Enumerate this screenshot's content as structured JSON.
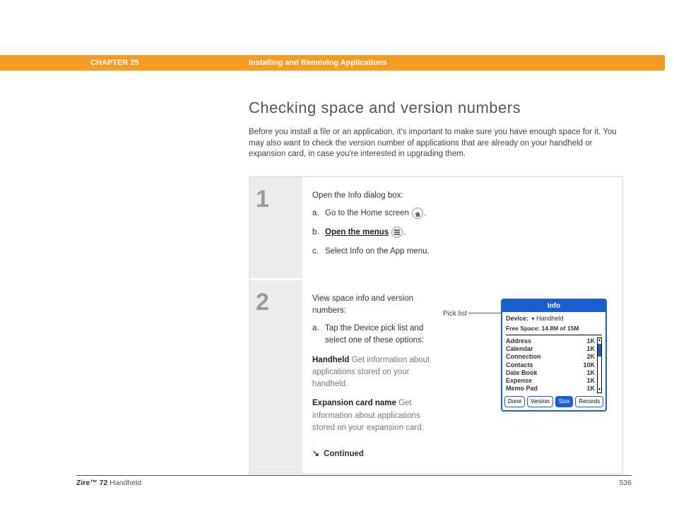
{
  "header": {
    "chapter": "CHAPTER 25",
    "title": "Installing and Removing Applications"
  },
  "page": {
    "heading": "Checking space and version numbers",
    "intro": "Before you install a file or an application, it's important to make sure you have enough space for it. You may also want to check the version number of applications that are already on your handheld or expansion card, in case you're interested in upgrading them."
  },
  "step1": {
    "num": "1",
    "lead": "Open the Info dialog box:",
    "a_letter": "a.",
    "a_text": "Go to the Home screen ",
    "a_post": ".",
    "b_letter": "b.",
    "b_link": "Open the menus",
    "b_post": ".",
    "c_letter": "c.",
    "c_text": "Select Info on the App menu."
  },
  "step2": {
    "num": "2",
    "lead": "View space info and version numbers:",
    "a_letter": "a.",
    "a_text": "Tap the Device pick list and select one of these options:",
    "def1_term": "Handheld",
    "def1_text": " Get information about applications stored on your handheld.",
    "def2_term": "Expansion card name",
    "def2_text": " Get information about applications stored on your expansion card.",
    "continued": "Continued",
    "picklist_label": "Pick list"
  },
  "info_dialog": {
    "title": "Info",
    "device_label": "Device:",
    "device_value": "Handheld",
    "free_space": "Free Space: 14.8M of 15M",
    "apps": [
      {
        "name": "Address",
        "size": "1K"
      },
      {
        "name": "Calendar",
        "size": "1K"
      },
      {
        "name": "Connection",
        "size": "2K"
      },
      {
        "name": "Contacts",
        "size": "10K"
      },
      {
        "name": "Date Book",
        "size": "1K"
      },
      {
        "name": "Expense",
        "size": "1K"
      },
      {
        "name": "Memo Pad",
        "size": "1K"
      }
    ],
    "btn_done": "Done",
    "btn_version": "Version",
    "btn_size": "Size",
    "btn_records": "Records"
  },
  "footer": {
    "product_bold": "Zire™ 72",
    "product_rest": " Handheld",
    "page_num": "536"
  }
}
